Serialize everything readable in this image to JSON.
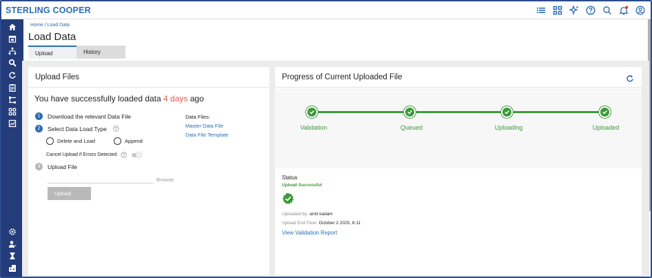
{
  "app": {
    "brand": "STERLING COOPER"
  },
  "header": {
    "breadcrumb": {
      "home": "Home",
      "current": "Load Data"
    },
    "title": "Load Data",
    "tabs": [
      {
        "label": "Upload"
      },
      {
        "label": "History"
      }
    ]
  },
  "upload_panel": {
    "title": "Upload Files",
    "message_prefix": "You have successfully loaded data ",
    "message_days": "4 days",
    "message_suffix": " ago",
    "steps": [
      {
        "num": "1",
        "label": "Download the relevant Data File"
      },
      {
        "num": "2",
        "label": "Select Data Load Type"
      },
      {
        "num": "3",
        "label": "Upload File"
      }
    ],
    "load_types": [
      "Delete and Load",
      "Append"
    ],
    "cancel_label": "Cancel Upload if Errors Detected",
    "browse_label": "Browse",
    "upload_button": "Upload",
    "data_files": {
      "label": "Data Files:",
      "links": [
        "Master Data File",
        "Data File Template"
      ]
    }
  },
  "progress_panel": {
    "title": "Progress of Current Uploaded File",
    "stages": [
      {
        "label": "Validation",
        "complete": true
      },
      {
        "label": "Queued",
        "complete": true
      },
      {
        "label": "Uploading",
        "complete": true
      },
      {
        "label": "Uploaded",
        "complete": true
      }
    ],
    "status_title": "Status",
    "status_text": "Upload Successful",
    "uploaded_by_label": "Uploaded by:",
    "uploaded_by": "amit kadam",
    "end_time_label": "Upload End Time:",
    "end_time": "October 2 2025, 8:11",
    "report_link": "View Validation Report"
  },
  "colors": {
    "brand": "#2a6db5",
    "sidebar": "#243c7a",
    "success": "#3d9a3b",
    "days": "#e0574f"
  },
  "icons": {
    "top": [
      "list-icon",
      "grid-icon",
      "sparkle-icon",
      "help-icon",
      "search-icon",
      "notification-bell-icon",
      "user-account-icon"
    ],
    "sidebar": [
      "home-icon",
      "calendar-icon",
      "hierarchy-icon",
      "search-icon",
      "refresh-icon",
      "clipboard-icon",
      "transfer-icon",
      "grid-icon",
      "report-icon",
      "settings-icon",
      "user-icon",
      "hourglass-icon",
      "building-icon"
    ]
  }
}
